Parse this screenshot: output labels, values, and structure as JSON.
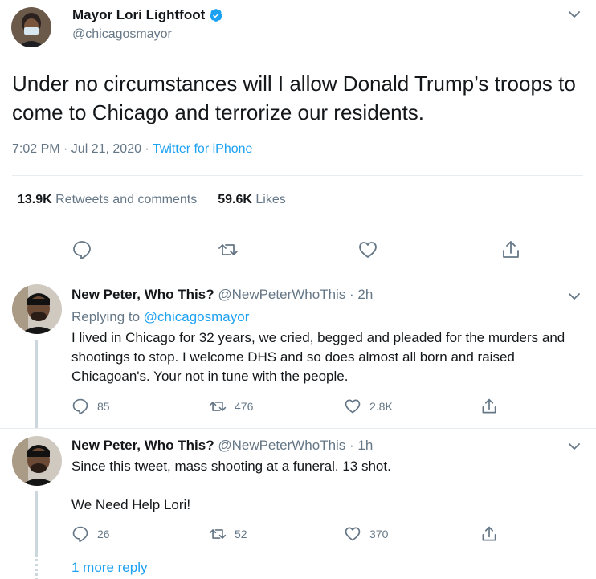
{
  "main_tweet": {
    "name": "Mayor Lori Lightfoot",
    "handle": "@chicagosmayor",
    "text": "Under no circumstances will I allow Donald Trump’s troops to come to Chicago and terrorize our residents.",
    "time": "7:02 PM · Jul 21, 2020 · ",
    "source": "Twitter for iPhone",
    "retweets_count": "13.9K",
    "retweets_label": "Retweets and comments",
    "likes_count": "59.6K",
    "likes_label": "Likes",
    "icons": [
      "reply-icon",
      "retweet-icon",
      "like-icon",
      "share-icon",
      "verified-badge-icon",
      "chevron-down-icon"
    ]
  },
  "replies": [
    {
      "name": "New Peter, Who This?",
      "handle": "@NewPeterWhoThis · 2h",
      "replying_prefix": "Replying to ",
      "replying_to": "@chicagosmayor",
      "text": "I lived in Chicago for 32 years, we cried, begged and pleaded for the murders and shootings to stop. I welcome DHS and so does almost all born and raised Chicagoan's.  Your not in tune with the people.",
      "reply_count": "85",
      "retweet_count": "476",
      "like_count": "2.8K"
    },
    {
      "name": "New Peter, Who This?",
      "handle": "@NewPeterWhoThis · 1h",
      "text_line1": "Since this tweet, mass shooting at a funeral. 13 shot.",
      "text_line2": "We Need Help Lori!",
      "reply_count": "26",
      "retweet_count": "52",
      "like_count": "370"
    }
  ],
  "more_replies_label": "1 more reply",
  "colors": {
    "accent": "#1da1f2",
    "text": "#14171a",
    "secondary": "#657786",
    "divider": "#e6ecf0",
    "thread_line": "#ccd6dd"
  }
}
